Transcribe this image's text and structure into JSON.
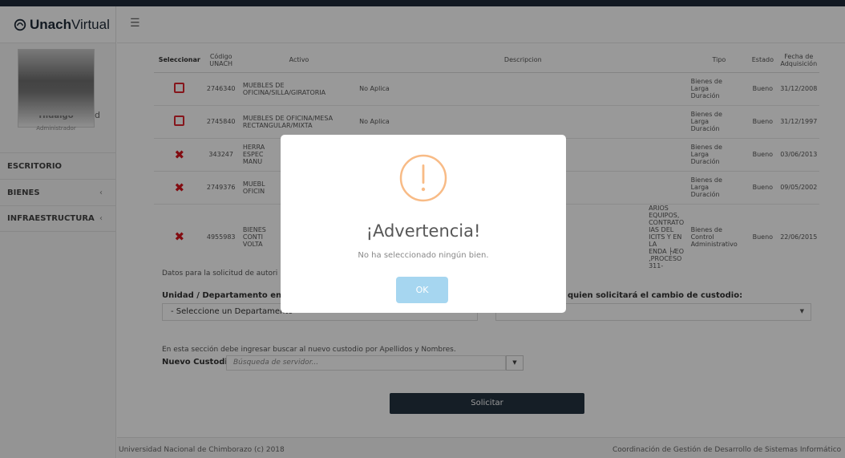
{
  "app": {
    "logo_bold": "Unach",
    "logo_light": "Virtual"
  },
  "user": {
    "name_partial": "Hidalgo",
    "name_tail": "d",
    "role": "Administrador"
  },
  "menu": [
    {
      "label": "ESCRITORIO",
      "chevron": ""
    },
    {
      "label": "BIENES",
      "chevron": "‹"
    },
    {
      "label": "INFRAESTRUCTURA",
      "chevron": "‹"
    }
  ],
  "header": {
    "menu_icon": "☰"
  },
  "table": {
    "headers": {
      "seleccionar": "Seleccionar",
      "codigo_1": "Código",
      "codigo_2": "UNACH",
      "activo": "Activo",
      "descripcion": "Descripcion",
      "tipo": "Tipo",
      "estado": "Estado",
      "fecha_1": "Fecha de",
      "fecha_2": "Adquisición"
    },
    "rows": [
      {
        "selected": false,
        "codigo": "2746340",
        "activo_1": "MUEBLES DE",
        "activo_2": "OFICINA/SILLA/GIRATORIA",
        "activo_3": "",
        "descripcion_1": "No Aplica",
        "descripcion_2": "",
        "descripcion_3": "",
        "tipo_1": "Bienes de",
        "tipo_2": "Larga",
        "tipo_3": "Duración",
        "estado": "Bueno",
        "fecha": "31/12/2008"
      },
      {
        "selected": false,
        "codigo": "2745840",
        "activo_1": "MUEBLES DE OFICINA/MESA",
        "activo_2": "RECTANGULAR/MIXTA",
        "activo_3": "",
        "descripcion_1": "No Aplica",
        "descripcion_2": "",
        "descripcion_3": "",
        "tipo_1": "Bienes de",
        "tipo_2": "Larga",
        "tipo_3": "Duración",
        "estado": "Bueno",
        "fecha": "31/12/1997"
      },
      {
        "selected": true,
        "codigo": "343247",
        "activo_1": "HERRA",
        "activo_2": "ESPEC",
        "activo_3": "MANU",
        "descripcion_1": "",
        "descripcion_2": "",
        "descripcion_3": "",
        "tipo_1": "Bienes de",
        "tipo_2": "Larga",
        "tipo_3": "Duración",
        "estado": "Bueno",
        "fecha": "03/06/2013"
      },
      {
        "selected": true,
        "codigo": "2749376",
        "activo_1": "MUEBL",
        "activo_2": "OFICIN",
        "activo_3": "",
        "descripcion_1": "",
        "descripcion_2": "",
        "descripcion_3": "",
        "tipo_1": "Bienes de",
        "tipo_2": "Larga",
        "tipo_3": "Duración",
        "estado": "Bueno",
        "fecha": "09/05/2002"
      },
      {
        "selected": true,
        "codigo": "4955983",
        "activo_1": "BIENES",
        "activo_2": "CONTI",
        "activo_3": "VOLTA",
        "descripcion_1": "ARIOS EQUIPOS, CONTRATO",
        "descripcion_2": "IAS DEL ICITS Y EN LA",
        "descripcion_3": "ENDA ├ÆO ,PROCESO 311-",
        "tipo_1": "Bienes de",
        "tipo_2": "Control",
        "tipo_3": "Administrativo",
        "estado": "Bueno",
        "fecha": "22/06/2015"
      }
    ]
  },
  "form": {
    "intro": "Datos para la solicitud de autori",
    "unidad_label": "Unidad / Departamento en la",
    "quien_label": "quien solicitará el cambio de custodio:",
    "departamento_value": "- Seleccione un Departamento",
    "search_intro": "En esta sección debe ingresar buscar al nuevo custodio por Apellidos y Nombres.",
    "nuevo_custodio_label": "Nuevo Custodio",
    "search_placeholder": "Búsqueda de servidor...",
    "submit_label": "Solicitar"
  },
  "footer": {
    "left": "Universidad Nacional de Chimborazo (c) 2018",
    "right": "Coordinación de Gestión de Desarrollo de Sistemas Informático"
  },
  "modal": {
    "title": "¡Advertencia!",
    "message": "No ha seleccionado ningún bien.",
    "ok_label": "OK",
    "icon": "warning-icon",
    "accent": "#f8bb86"
  }
}
